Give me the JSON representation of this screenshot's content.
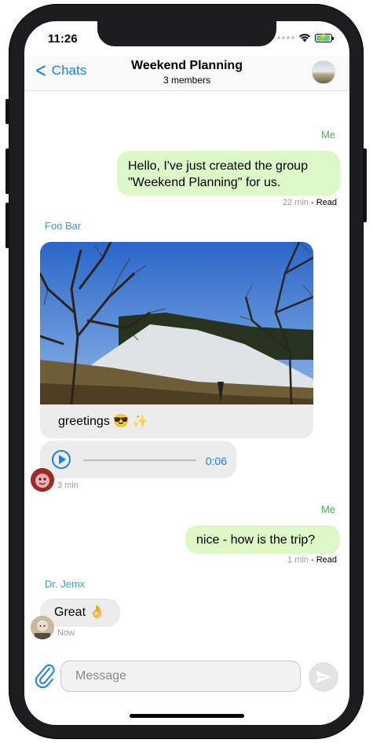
{
  "status": {
    "time": "11:26"
  },
  "nav": {
    "back_label": "Chats",
    "title": "Weekend Planning",
    "subtitle": "3 members"
  },
  "messages": [
    {
      "sender": "Me",
      "text_line1": "Hello, I've just created the group",
      "text_line2": "\"Weekend Planning\" for us.",
      "time": "22 min",
      "status": " - Read"
    },
    {
      "sender": "Foo Bar",
      "caption": "greetings 😎 ✨",
      "audio_duration": "0:06",
      "time": "3 min"
    },
    {
      "sender": "Me",
      "text": "nice - how is the trip?",
      "time": "1 min",
      "status": " - Read"
    },
    {
      "sender": "Dr. Jemx",
      "text": "Great 👌",
      "time": "Now"
    }
  ],
  "composer": {
    "placeholder": "Message"
  },
  "colors": {
    "accent": "#147efb",
    "my_bubble": "#dcf8c6",
    "their_bubble": "#ececec",
    "me_name": "#4caf50",
    "other_name": "#34a0d8"
  }
}
